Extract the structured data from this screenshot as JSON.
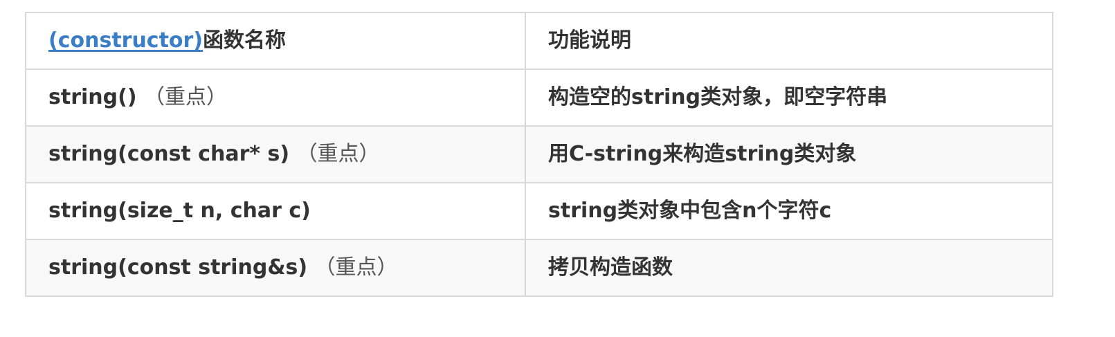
{
  "table": {
    "header": {
      "col1_link": "(constructor)",
      "col1_text": "函数名称",
      "col2": "功能说明"
    },
    "rows": [
      {
        "signature": "string()",
        "note": "（重点）",
        "description": "构造空的string类对象，即空字符串"
      },
      {
        "signature": "string(const char* s)",
        "note": "（重点）",
        "description": "用C-string来构造string类对象"
      },
      {
        "signature": "string(size_t n, char c)",
        "note": "",
        "description": "string类对象中包含n个字符c"
      },
      {
        "signature": "string(const string&s)",
        "note": "（重点）",
        "description": "拷贝构造函数"
      }
    ]
  },
  "colors": {
    "link": "#3b7ec8",
    "border": "#d9d9d9",
    "stripe": "#f8f8f8",
    "text": "#333333"
  }
}
